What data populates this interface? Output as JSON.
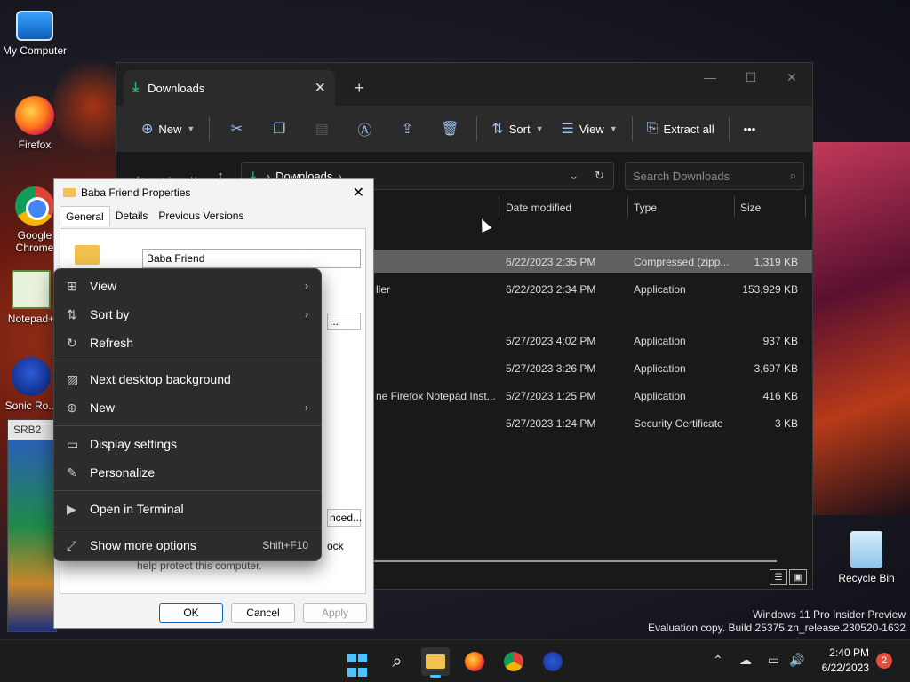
{
  "desktop": {
    "icons": [
      {
        "label": "My Computer"
      },
      {
        "label": "Firefox"
      },
      {
        "label": "Google Chrome"
      },
      {
        "label": "Notepad+"
      },
      {
        "label": "Sonic Ro..."
      },
      {
        "label": "Recycle Bin"
      }
    ],
    "background_window_title": "SRB2"
  },
  "explorer": {
    "tab_title": "Downloads",
    "new_tab": "+",
    "commands": {
      "new": "New",
      "sort": "Sort",
      "view": "View",
      "extract_all": "Extract all",
      "more": "•••"
    },
    "address": {
      "location": "Downloads"
    },
    "search_placeholder": "Search Downloads",
    "columns": {
      "date": "Date modified",
      "type": "Type",
      "size": "Size"
    },
    "rows": [
      {
        "name": "",
        "date": "6/22/2023 2:35 PM",
        "type": "Compressed (zipp...",
        "size": "1,319 KB",
        "selected": true
      },
      {
        "name": "ller",
        "date": "6/22/2023 2:34 PM",
        "type": "Application",
        "size": "153,929 KB"
      },
      {
        "name": "",
        "date": "5/27/2023 4:02 PM",
        "type": "Application",
        "size": "937 KB"
      },
      {
        "name": "",
        "date": "5/27/2023 3:26 PM",
        "type": "Application",
        "size": "3,697 KB"
      },
      {
        "name": "ne Firefox Notepad Inst...",
        "date": "5/27/2023 1:25 PM",
        "type": "Application",
        "size": "416 KB"
      },
      {
        "name": "",
        "date": "5/27/2023 1:24 PM",
        "type": "Security Certificate",
        "size": "3 KB"
      }
    ]
  },
  "properties": {
    "title": "Baba Friend Properties",
    "tabs": [
      "General",
      "Details",
      "Previous Versions"
    ],
    "name_value": "Baba Friend",
    "partial_buttons": {
      "change": "...",
      "advanced": "nced...",
      "unblock": "ock"
    },
    "help_text": "help protect this computer.",
    "buttons": {
      "ok": "OK",
      "cancel": "Cancel",
      "apply": "Apply"
    }
  },
  "context_menu": {
    "items": [
      {
        "label": "View",
        "icon": "grid-icon"
      },
      {
        "label": "Sort by",
        "icon": "sort-icon"
      },
      {
        "label": "Refresh",
        "icon": "refresh-icon"
      },
      {
        "label": "Next desktop background",
        "icon": "image-icon"
      },
      {
        "label": "New",
        "icon": "plus-circle-icon"
      },
      {
        "label": "Display settings",
        "icon": "monitor-icon"
      },
      {
        "label": "Personalize",
        "icon": "pen-icon"
      },
      {
        "label": "Open in Terminal",
        "icon": "terminal-icon"
      },
      {
        "label": "Show more options",
        "icon": "expand-icon",
        "shortcut": "Shift+F10"
      }
    ]
  },
  "watermark": {
    "line1": "Windows 11 Pro Insider Preview",
    "line2": "Evaluation copy. Build 25375.zn_release.230520-1632"
  },
  "taskbar": {
    "time": "2:40 PM",
    "date": "6/22/2023",
    "notifications": "2"
  }
}
